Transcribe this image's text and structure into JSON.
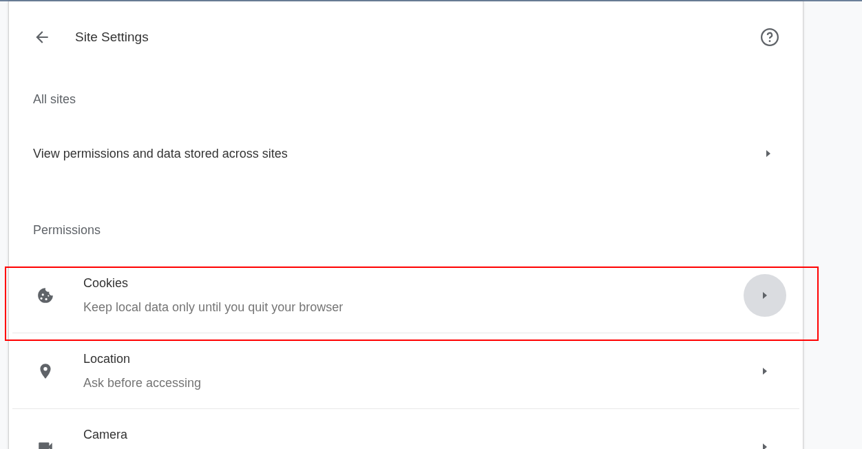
{
  "header": {
    "title": "Site Settings"
  },
  "sections": [
    {
      "heading": "All sites",
      "items": [
        {
          "kind": "link",
          "title": "View permissions and data stored across sites",
          "hovered": false,
          "highlighted": false
        }
      ]
    },
    {
      "heading": "Permissions",
      "items": [
        {
          "kind": "cookie",
          "title": "Cookies",
          "subtitle": "Keep local data only until you quit your browser",
          "hovered": true,
          "highlighted": true
        },
        {
          "kind": "location",
          "title": "Location",
          "subtitle": "Ask before accessing",
          "hovered": false,
          "highlighted": false
        },
        {
          "kind": "camera",
          "title": "Camera",
          "hovered": false,
          "highlighted": false
        }
      ]
    }
  ]
}
